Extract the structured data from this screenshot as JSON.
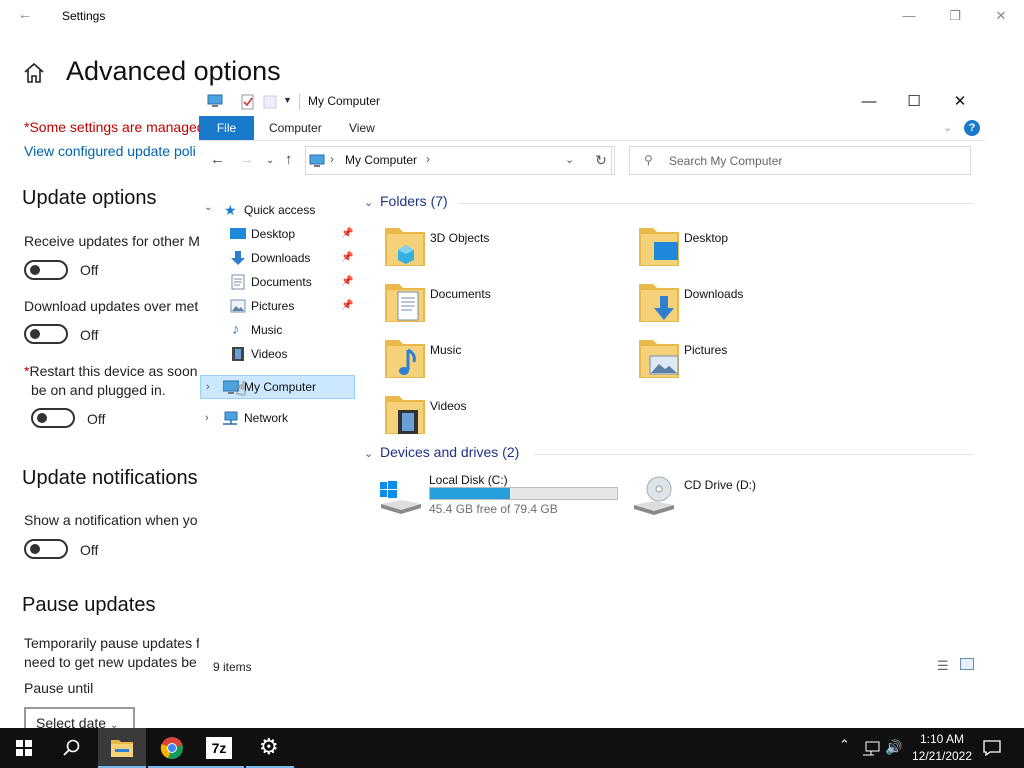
{
  "settings": {
    "window_title": "Settings",
    "page_title": "Advanced options",
    "managed_notice": "*Some settings are managed",
    "policy_link": "View configured update poli",
    "update_options_heading": "Update options",
    "receive_updates_label": "Receive updates for other M",
    "receive_updates_state": "Off",
    "metered_label": "Download updates over met",
    "metered_state": "Off",
    "restart_label_star": "*",
    "restart_label_line1": "Restart this device as soon",
    "restart_label_line2": "be on and plugged in.",
    "restart_state": "Off",
    "notifications_heading": "Update notifications",
    "notification_label": "Show a notification when yo",
    "notification_state": "Off",
    "pause_heading": "Pause updates",
    "pause_desc_line1": "Temporarily pause updates f",
    "pause_desc_line2": "need to get new updates be",
    "pause_until_label": "Pause until",
    "select_date": "Select date"
  },
  "explorer": {
    "title": "My Computer",
    "ribbon": {
      "file": "File",
      "computer": "Computer",
      "view": "View"
    },
    "address": "My Computer",
    "search_placeholder": "Search My Computer",
    "nav": {
      "quick_access": "Quick access",
      "items": [
        {
          "label": "Desktop",
          "pinned": true
        },
        {
          "label": "Downloads",
          "pinned": true
        },
        {
          "label": "Documents",
          "pinned": true
        },
        {
          "label": "Pictures",
          "pinned": true
        },
        {
          "label": "Music",
          "pinned": false
        },
        {
          "label": "Videos",
          "pinned": false
        }
      ],
      "my_computer": "My Computer",
      "network": "Network"
    },
    "folders_group": "Folders (7)",
    "folders": [
      "3D Objects",
      "Desktop",
      "Documents",
      "Downloads",
      "Music",
      "Pictures",
      "Videos"
    ],
    "devices_group": "Devices and drives (2)",
    "drives": {
      "c_label": "Local Disk (C:)",
      "c_free": "45.4 GB free of 79.4 GB",
      "c_used_fraction": 0.428,
      "d_label": "CD Drive (D:)"
    },
    "status": "9 items"
  },
  "taskbar": {
    "time": "1:10 AM",
    "date": "12/21/2022",
    "apps": [
      "start-icon",
      "search-icon",
      "file-explorer-icon",
      "chrome-icon",
      "7zip-icon",
      "settings-icon"
    ],
    "sevenzip_label": "7z"
  },
  "colors": {
    "accent": "#1979ca",
    "selected": "#cce8ff",
    "warning": "#c00000",
    "link": "#0063b1",
    "drive_bar": "#26a0da"
  }
}
